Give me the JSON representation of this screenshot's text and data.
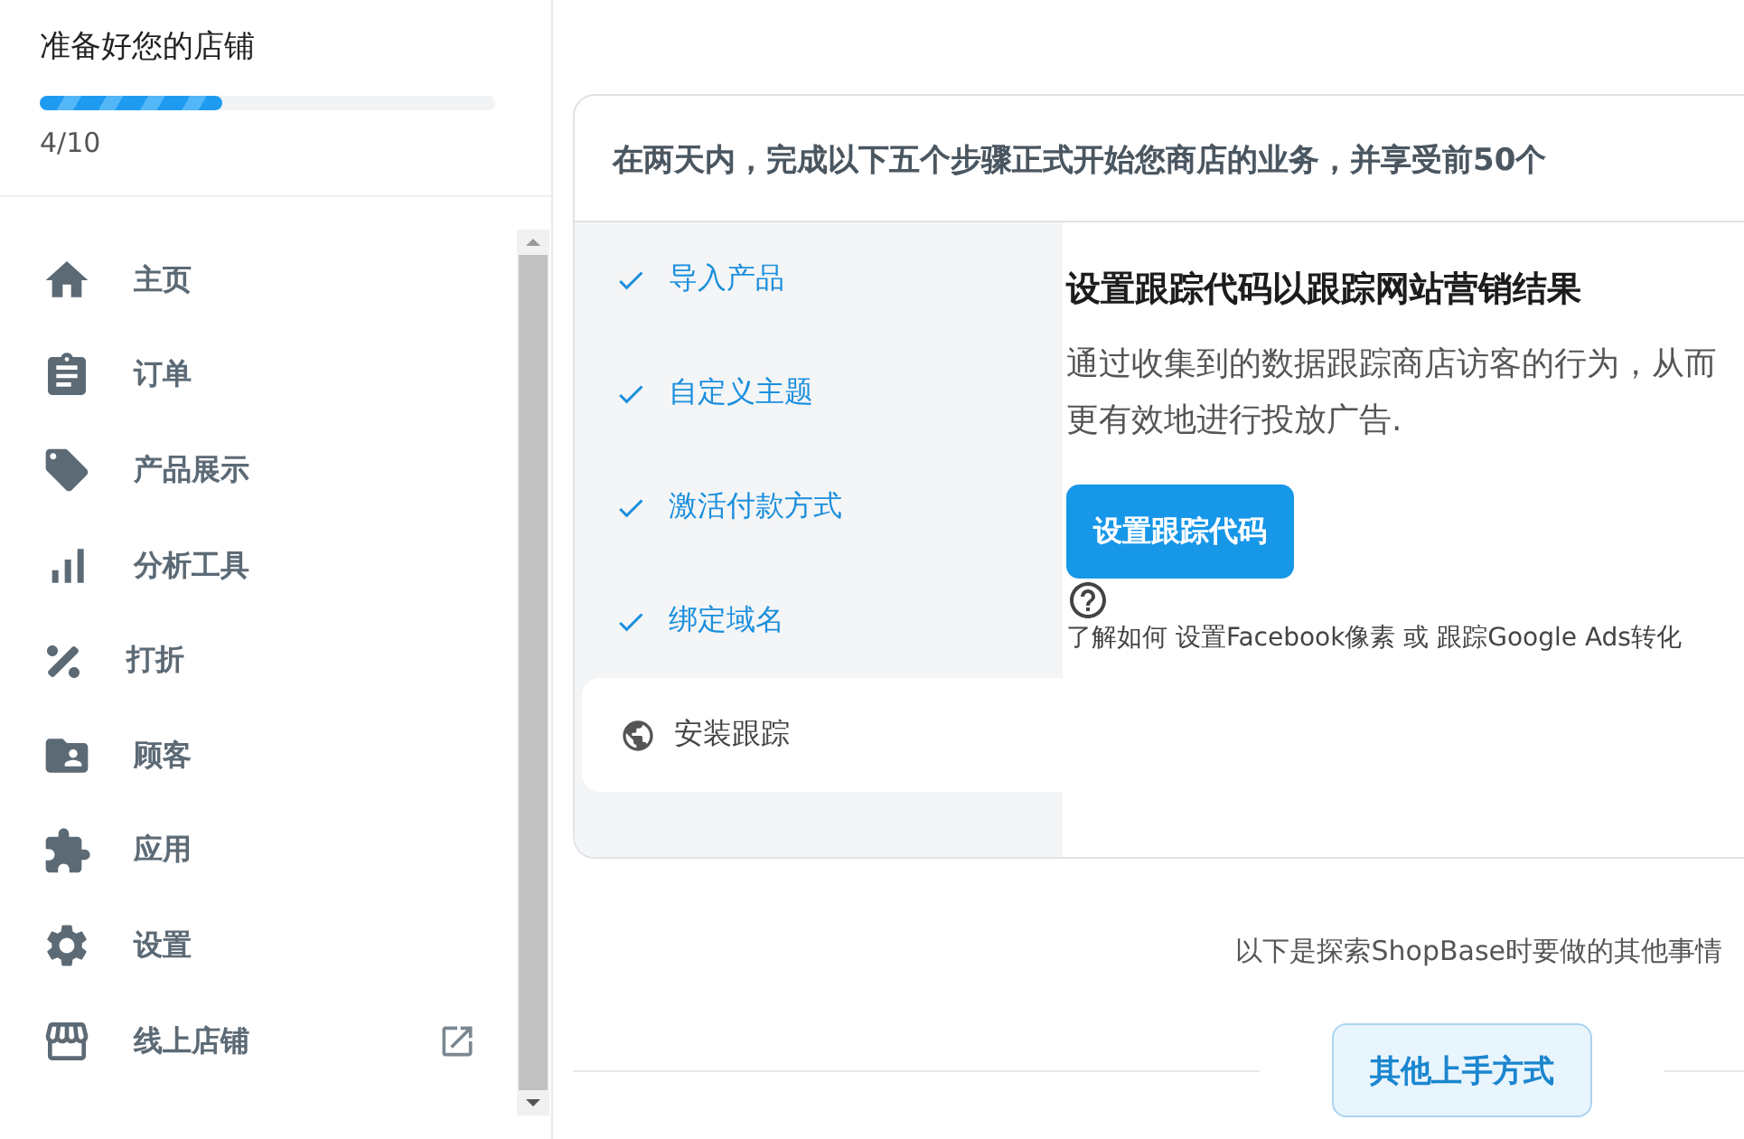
{
  "sidebar": {
    "title": "准备好您的店铺",
    "progress": {
      "level": 0.4,
      "reading": "4/10"
    },
    "items": [
      {
        "label": "主页"
      },
      {
        "label": "订单"
      },
      {
        "label": "产品展示"
      },
      {
        "label": "分析工具"
      },
      {
        "label": "打折"
      },
      {
        "label": "顾客"
      },
      {
        "label": "应用"
      },
      {
        "label": "设置"
      },
      {
        "label": "线上店铺",
        "external": true
      }
    ]
  },
  "setup_card": {
    "header": "在两天内，完成以下五个步骤正式开始您商店的业务，并享受前50个",
    "steps": [
      {
        "label": "导入产品",
        "done": true,
        "selected": false
      },
      {
        "label": "自定义主题",
        "done": true,
        "selected": false
      },
      {
        "label": "激活付款方式",
        "done": true,
        "selected": false
      },
      {
        "label": "绑定域名",
        "done": true,
        "selected": false
      },
      {
        "label": "安装跟踪",
        "done": false,
        "selected": true
      }
    ],
    "detail": {
      "title": "设置跟踪代码以跟踪网站营销结果",
      "description": "通过收集到的数据跟踪商店访客的行为，从而更有效地进行投放广告.",
      "button": "设置跟踪代码",
      "help_text": "了解如何 设置Facebook像素 或 跟踪Google Ads转化"
    }
  },
  "more": {
    "text": "以下是探索ShopBase时要做的其他事情",
    "button": "其他上手方式"
  }
}
